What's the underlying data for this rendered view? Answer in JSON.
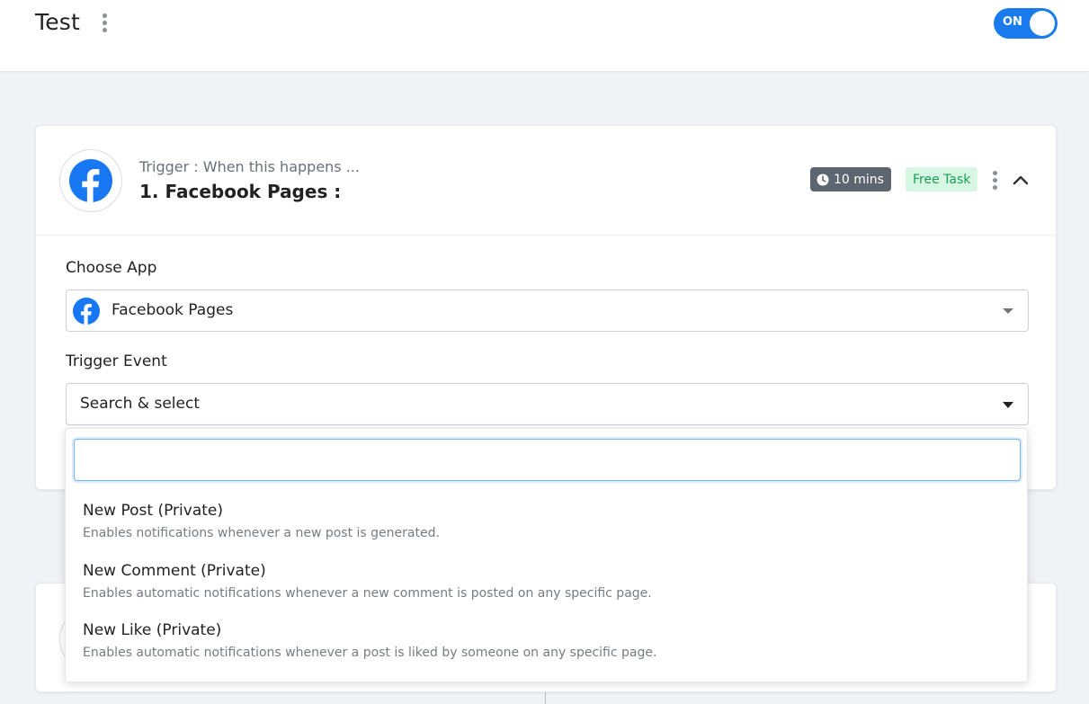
{
  "header": {
    "title": "Test",
    "toggle_label": "ON"
  },
  "trigger_card": {
    "subtitle": "Trigger : When this happens ...",
    "title": "1. Facebook Pages :",
    "time_badge": "10 mins",
    "free_badge": "Free Task",
    "choose_app_label": "Choose App",
    "selected_app": "Facebook Pages",
    "trigger_event_label": "Trigger Event",
    "trigger_event_placeholder": "Search & select"
  },
  "dropdown": {
    "search_value": "",
    "options": [
      {
        "title": "New Post (Private)",
        "desc": "Enables notifications whenever a new post is generated."
      },
      {
        "title": "New Comment (Private)",
        "desc": "Enables automatic notifications whenever a new comment is posted on any specific page."
      },
      {
        "title": "New Like (Private)",
        "desc": "Enables automatic notifications whenever a post is liked by someone on any specific page."
      }
    ]
  },
  "colors": {
    "toggle_on": "#1a7bef",
    "facebook_blue": "#1877f2",
    "free_badge_bg": "#d7f6e4",
    "free_badge_text": "#1a9e55",
    "time_badge_bg": "#5d6670"
  },
  "icons": [
    "more-vertical-icon",
    "facebook-icon",
    "clock-icon",
    "chevron-up-icon",
    "caret-down-icon"
  ]
}
